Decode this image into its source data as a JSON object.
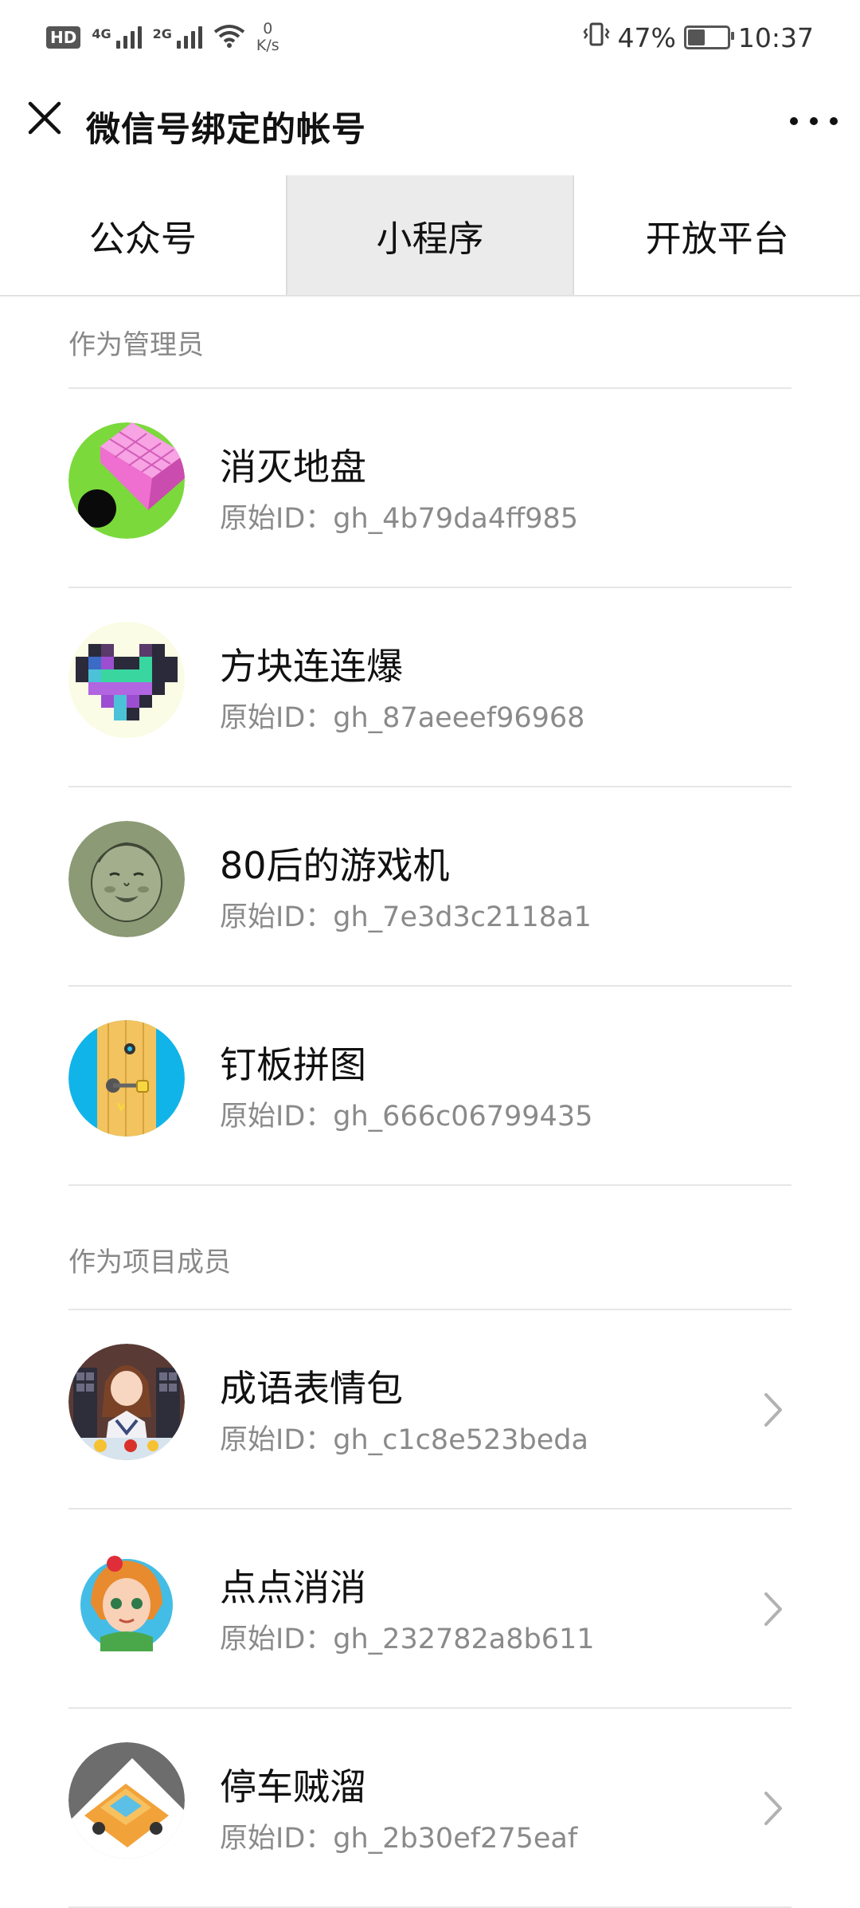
{
  "status_bar": {
    "hd_badge": "HD",
    "net_1": "4G",
    "net_2": "2G",
    "speed_value": "0",
    "speed_unit": "K/s",
    "battery_percent": "47%",
    "battery_level": 0.47,
    "time": "10:37"
  },
  "header": {
    "title": "微信号绑定的帐号"
  },
  "tabs": [
    {
      "label": "公众号",
      "active": false
    },
    {
      "label": "小程序",
      "active": true
    },
    {
      "label": "开放平台",
      "active": false
    }
  ],
  "sections": {
    "admin": {
      "label": "作为管理员",
      "items": [
        {
          "name": "消灭地盘",
          "original_id": "原始ID：gh_4b79da4ff985",
          "icon": "pink-cube-avatar-icon"
        },
        {
          "name": "方块连连爆",
          "original_id": "原始ID：gh_87aeeef96968",
          "icon": "pixel-heart-avatar-icon"
        },
        {
          "name": "80后的游戏机",
          "original_id": "原始ID：gh_7e3d3c2118a1",
          "icon": "baby-sketch-avatar-icon"
        },
        {
          "name": "钉板拼图",
          "original_id": "原始ID：gh_666c06799435",
          "icon": "wood-board-avatar-icon"
        }
      ]
    },
    "member": {
      "label": "作为项目成员",
      "items": [
        {
          "name": "成语表情包",
          "original_id": "原始ID：gh_c1c8e523beda",
          "icon": "anime-girl-avatar-icon"
        },
        {
          "name": "点点消消",
          "original_id": "原始ID：gh_232782a8b611",
          "icon": "cartoon-girl-avatar-icon"
        },
        {
          "name": "停车贼溜",
          "original_id": "原始ID：gh_2b30ef275eaf",
          "icon": "yellow-car-avatar-icon"
        }
      ]
    }
  }
}
